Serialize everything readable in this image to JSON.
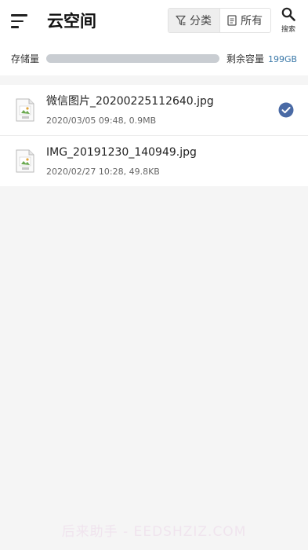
{
  "header": {
    "title": "云空间",
    "filter": {
      "classify_label": "分类",
      "all_label": "所有"
    },
    "search_label": "搜索"
  },
  "storage": {
    "label": "存储量",
    "used_fraction": 1.0,
    "remaining_label": "剩余容量",
    "remaining_value": "199GB"
  },
  "files": [
    {
      "name": "微信图片_20200225112640.jpg",
      "meta": "2020/03/05   09:48, 0.9MB",
      "selected": true
    },
    {
      "name": "IMG_20191230_140949.jpg",
      "meta": "2020/02/27   10:28, 49.8KB",
      "selected": false
    }
  ],
  "watermark": "后来助手 - EEDSHZIZ.COM",
  "colors": {
    "accent": "#3a78a8",
    "check": "#4a6aa5",
    "bar": "#d3d6da"
  }
}
